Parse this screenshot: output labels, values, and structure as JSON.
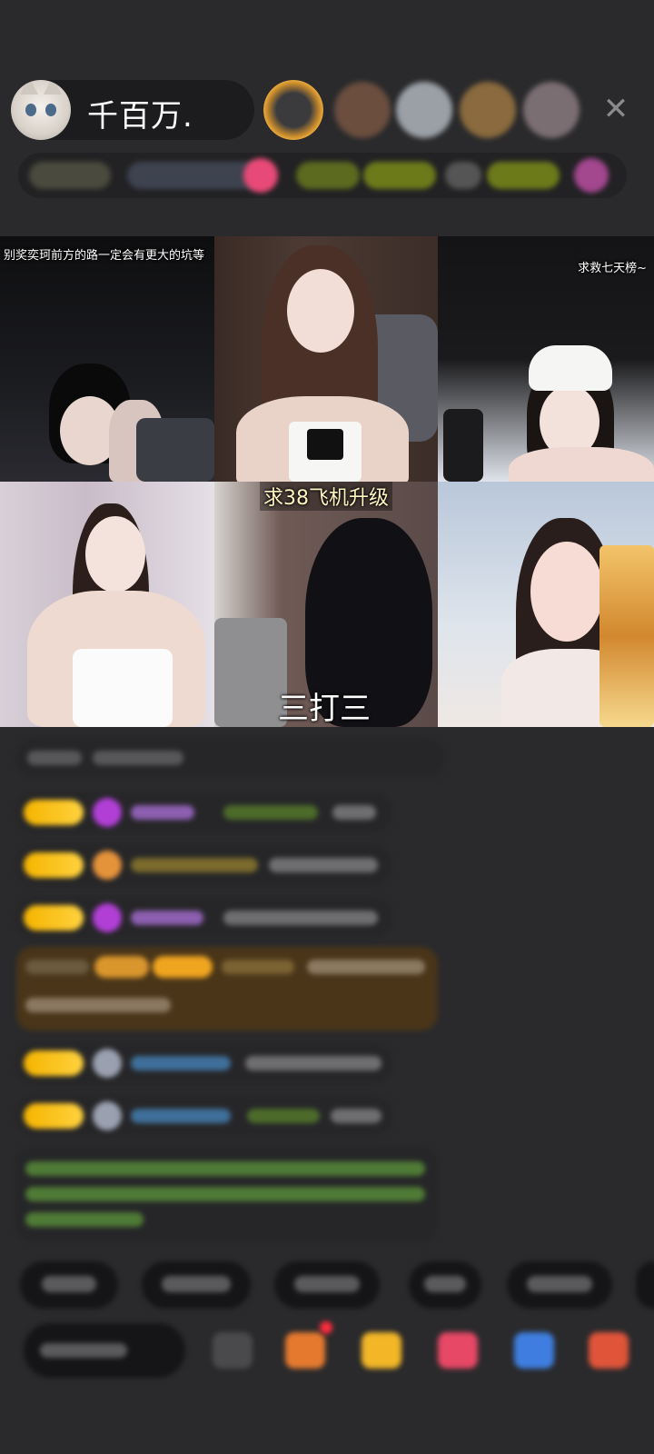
{
  "header": {
    "host_name": "千百万.",
    "close_glyph": "✕"
  },
  "tiles": [
    {
      "caption": "别奖奕珂前方的路一定会有更大的坑等"
    },
    {
      "caption": ""
    },
    {
      "caption": "求救七天榜~"
    },
    {
      "caption": ""
    },
    {
      "caption": "求38飞机升级",
      "subtitle": "三打三"
    },
    {
      "caption": ""
    }
  ],
  "colors": {
    "background": "#2a2a2c",
    "badge_gold": "#f5b400",
    "highlight_row": "#4a3519",
    "green_text": "#4f7a35"
  }
}
